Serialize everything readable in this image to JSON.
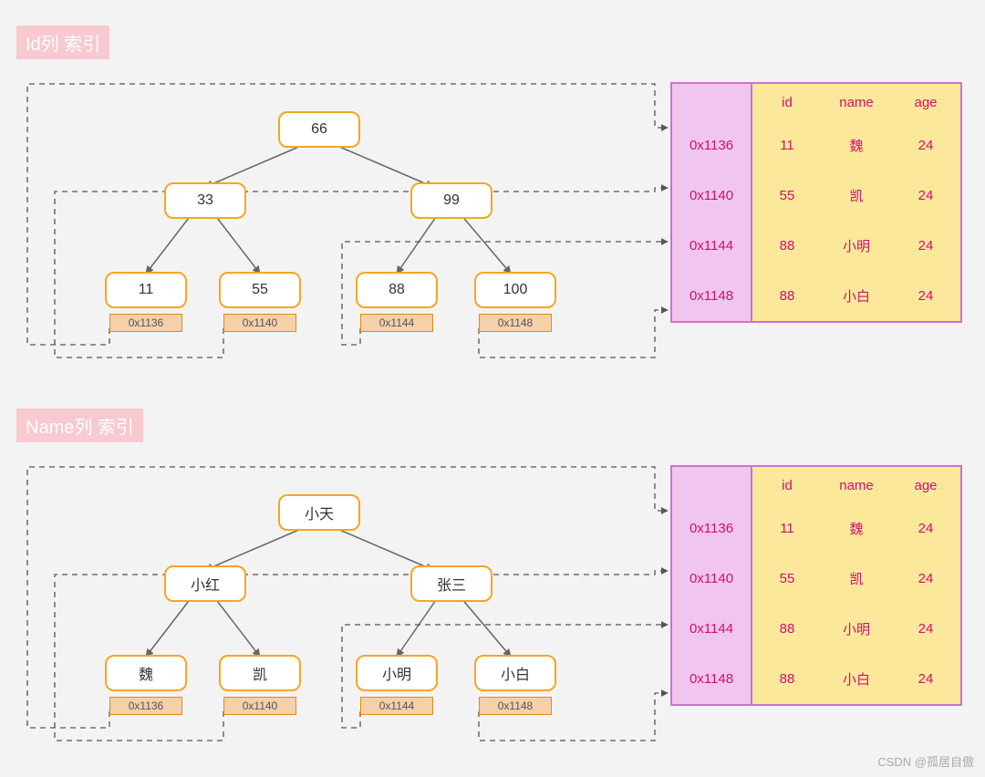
{
  "titles": {
    "id": "Id列 索引",
    "name": "Name列 索引"
  },
  "tree1": {
    "root": "66",
    "l": "33",
    "r": "99",
    "ll": "11",
    "lr": "55",
    "rl": "88",
    "rr": "100",
    "a_ll": "0x1136",
    "a_lr": "0x1140",
    "a_rl": "0x1144",
    "a_rr": "0x1148"
  },
  "tree2": {
    "root": "小天",
    "l": "小红",
    "r": "张三",
    "ll": "魏",
    "lr": "凯",
    "rl": "小明",
    "rr": "小白",
    "a_ll": "0x1136",
    "a_lr": "0x1140",
    "a_rl": "0x1144",
    "a_rr": "0x1148"
  },
  "table": {
    "headers": {
      "id": "id",
      "name": "name",
      "age": "age"
    },
    "addrs": [
      "0x1136",
      "0x1140",
      "0x1144",
      "0x1148"
    ],
    "rows": [
      {
        "id": "11",
        "name": "魏",
        "age": "24"
      },
      {
        "id": "55",
        "name": "凯",
        "age": "24"
      },
      {
        "id": "88",
        "name": "小明",
        "age": "24"
      },
      {
        "id": "88",
        "name": "小白",
        "age": "24"
      }
    ]
  },
  "watermark": "CSDN @孤居自傲"
}
